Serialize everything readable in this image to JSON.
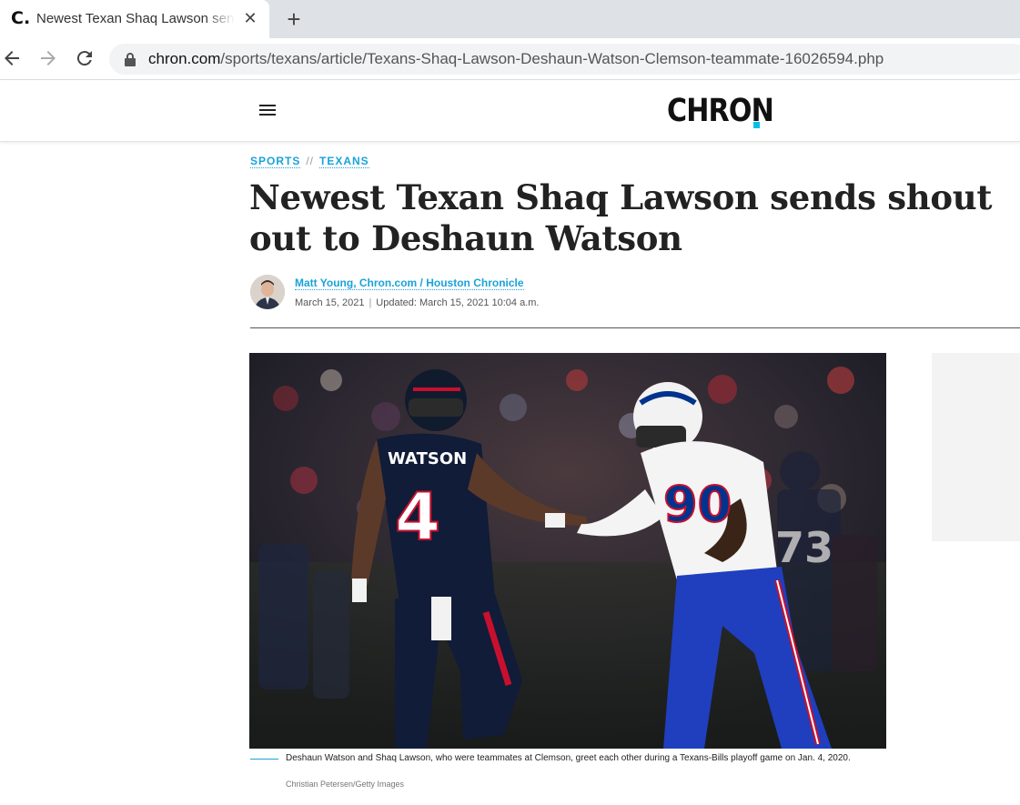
{
  "browser": {
    "tab_title": "Newest Texan Shaq Lawson sends shout out to Deshaun Watson",
    "favicon_letter": "C.",
    "close_glyph": "✕",
    "newtab_glyph": "+",
    "url_host": "chron.com",
    "url_path": "/sports/texans/article/Texans-Shaq-Lawson-Deshaun-Watson-Clemson-teammate-16026594.php"
  },
  "site": {
    "logo_text": "CHRON",
    "accent_color": "#00c0e8"
  },
  "article": {
    "kicker": [
      "SPORTS",
      "TEXANS"
    ],
    "kicker_sep": "//",
    "headline": "Newest Texan Shaq Lawson sends shout out to Deshaun Watson",
    "author": "Matt Young, Chron.com / Houston Chronicle",
    "published": "March 15, 2021",
    "updated": "Updated: March 15, 2021 10:04 a.m.",
    "date_sep": "|",
    "photo": {
      "left_jersey_name": "WATSON",
      "left_jersey_number": "4",
      "right_jersey_number": "90",
      "background_jersey_number": "73"
    },
    "caption": "Deshaun Watson and Shaq Lawson, who were teammates at Clemson, greet each other during a Texans-Bills playoff game on Jan. 4, 2020.",
    "credit": "Christian Petersen/Getty Images"
  }
}
